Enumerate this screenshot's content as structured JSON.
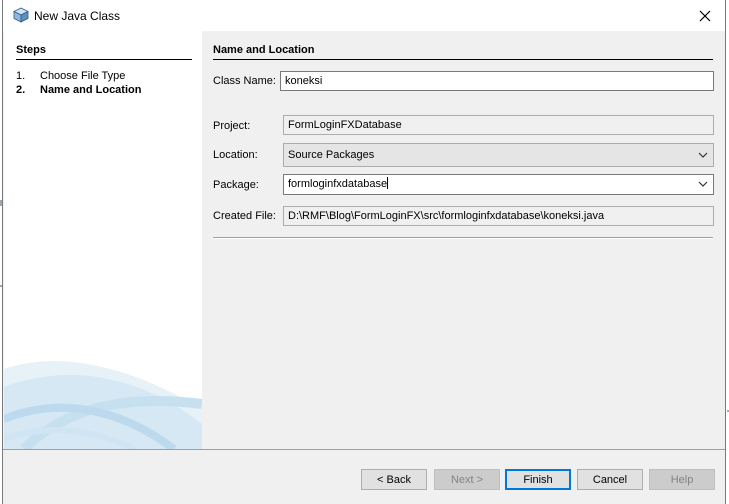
{
  "window": {
    "title": "New Java Class"
  },
  "steps": {
    "title": "Steps",
    "items": [
      {
        "num": "1.",
        "label": "Choose File Type"
      },
      {
        "num": "2.",
        "label": "Name and Location"
      }
    ]
  },
  "section": {
    "title": "Name and Location"
  },
  "form": {
    "class_name_label": "Class Name:",
    "class_name_value": "koneksi",
    "project_label": "Project:",
    "project_value": "FormLoginFXDatabase",
    "location_label": "Location:",
    "location_value": "Source Packages",
    "package_label": "Package:",
    "package_value": "formloginfxdatabase",
    "created_file_label": "Created File:",
    "created_file_value": "D:\\RMF\\Blog\\FormLoginFX\\src\\formloginfxdatabase\\koneksi.java"
  },
  "buttons": {
    "back": "< Back",
    "next": "Next >",
    "finish": "Finish",
    "cancel": "Cancel",
    "help": "Help"
  },
  "colors": {
    "accent": "#0078d7",
    "panel": "#f0f0f0"
  }
}
